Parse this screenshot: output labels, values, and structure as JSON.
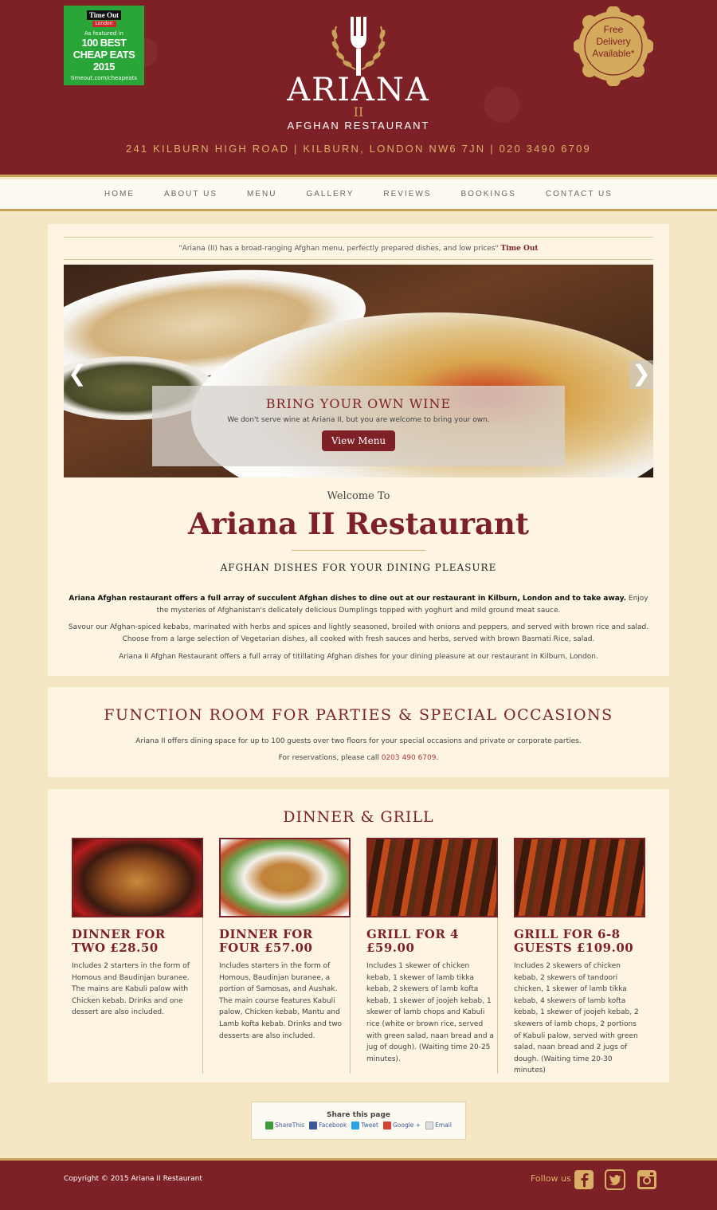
{
  "badge": {
    "logo": "Time Out",
    "city": "London",
    "featured": "As featured in",
    "headline": "100 BEST CHEAP EATS 2015",
    "url": "timeout.com/cheapeats"
  },
  "brand": {
    "name": "ARIANA",
    "suffix": "II",
    "subtitle": "AFGHAN RESTAURANT",
    "address": "241 KILBURN HIGH ROAD | KILBURN, LONDON NW6 7JN | 020 3490 6709"
  },
  "delivery_seal": {
    "line1": "Free",
    "line2": "Delivery",
    "line3": "Available*"
  },
  "nav": [
    "HOME",
    "ABOUT US",
    "MENU",
    "GALLERY",
    "REVIEWS",
    "BOOKINGS",
    "CONTACT US"
  ],
  "quote": {
    "text": "\"Ariana (II) has a broad-ranging Afghan menu, perfectly prepared dishes, and low prices\"",
    "source": "Time Out"
  },
  "slider": {
    "heading": "BRING YOUR OWN WINE",
    "text": "We don't serve wine at Ariana II, but you are welcome to bring your own.",
    "button": "View Menu"
  },
  "welcome": {
    "intro": "Welcome To",
    "title": "Ariana II Restaurant",
    "tagline": "AFGHAN DISHES FOR YOUR DINING PLEASURE",
    "p1_bold": "Ariana Afghan restaurant offers a full array of succulent Afghan dishes to dine out at our restaurant in Kilburn, London and to take away.",
    "p1_rest": " Enjoy the mysteries of Afghanistan's delicately delicious Dumplings topped with yoghurt and mild ground meat sauce.",
    "p2": "Savour our Afghan-spiced kebabs, marinated with herbs and spices and lightly seasoned, broiled with onions and peppers, and served with brown rice and salad. Choose from a large selection of Vegetarian dishes, all cooked with fresh sauces and herbs, served with brown Basmati Rice, salad.",
    "p3": "Ariana II Afghan Restaurant offers a full array of titillating Afghan dishes for your dining pleasure at our restaurant in Kilburn, London."
  },
  "function_room": {
    "heading": "FUNCTION ROOM FOR PARTIES & SPECIAL OCCASIONS",
    "line1": "Ariana II offers dining space for up to 100 guests over two floors for your special occasions and private or corporate parties.",
    "line2_prefix": "For reservations, please call ",
    "phone": "0203 490 6709",
    "line2_suffix": "."
  },
  "dinner": {
    "heading": "DINNER & GRILL",
    "cards": [
      {
        "title": "DINNER FOR TWO £28.50",
        "text": "Includes 2 starters in the form of Homous and Baudinjan buranee. The mains are Kabuli palow with Chicken kebab. Drinks and one dessert are also included."
      },
      {
        "title": "DINNER FOR FOUR £57.00",
        "text": "Includes starters in the form of Homous, Baudinjan buranee, a portion of Samosas, and Aushak. The main course features Kabuli palow, Chicken kebab, Mantu and Lamb kofta kebab. Drinks and two desserts are also included."
      },
      {
        "title": "GRILL FOR 4 £59.00",
        "text": "Includes 1 skewer of chicken kebab, 1 skewer of lamb tikka kebab, 2 skewers of lamb kofta kebab, 1 skewer of joojeh kebab, 1 skewer of lamb chops and Kabuli rice (white or brown rice, served with green salad, naan bread and a jug of dough). (Waiting time 20-25 minutes)."
      },
      {
        "title": "GRILL FOR 6-8 GUESTS £109.00",
        "text": "Includes 2 skewers of chicken kebab, 2 skewers of tandoori chicken, 1 skewer of lamb tikka kebab, 4 skewers of lamb kofta kebab, 1 skewer of joojeh kebab, 2 skewers of lamb chops, 2 portions of Kabuli palow, served with green salad, naan bread and 2 jugs of dough. (Waiting time 20-30 minutes)"
      }
    ]
  },
  "share": {
    "title": "Share this page",
    "items": [
      "ShareThis",
      "Facebook",
      "Tweet",
      "Google +",
      "Email"
    ]
  },
  "footer": {
    "copyright": "Copyright © 2015 Ariana II Restaurant",
    "follow": "Follow us"
  },
  "colors": {
    "brand": "#7e2126",
    "gold": "#c9a25a",
    "background": "#f6e7c4"
  }
}
